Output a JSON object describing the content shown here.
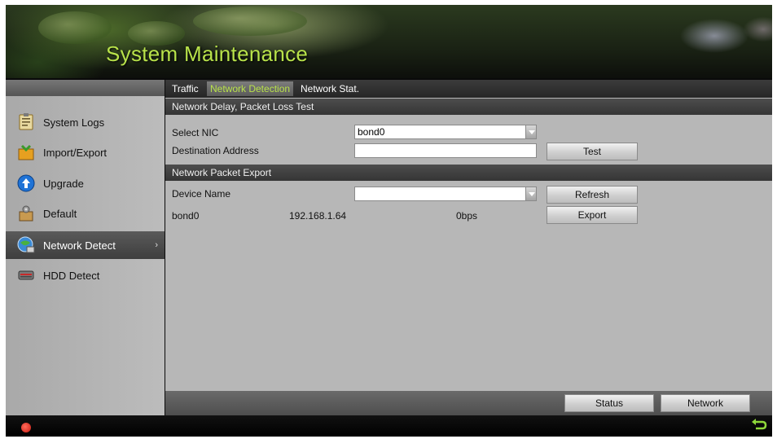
{
  "header": {
    "title": "System Maintenance"
  },
  "sidebar": {
    "items": [
      {
        "label": "System Logs",
        "icon": "system-logs-icon"
      },
      {
        "label": "Import/Export",
        "icon": "import-export-icon"
      },
      {
        "label": "Upgrade",
        "icon": "upgrade-icon"
      },
      {
        "label": "Default",
        "icon": "default-icon"
      },
      {
        "label": "Network Detect",
        "icon": "network-detect-icon",
        "active": true
      },
      {
        "label": "HDD Detect",
        "icon": "hdd-detect-icon"
      }
    ],
    "active_chevron": "›"
  },
  "tabs": [
    {
      "label": "Traffic"
    },
    {
      "label": "Network Detection",
      "active": true
    },
    {
      "label": "Network Stat."
    }
  ],
  "delay_test": {
    "header": "Network Delay, Packet Loss Test",
    "select_nic_label": "Select NIC",
    "select_nic_value": "bond0",
    "destination_label": "Destination Address",
    "destination_value": "",
    "test_button": "Test"
  },
  "packet_export": {
    "header": "Network Packet Export",
    "device_name_label": "Device Name",
    "device_name_value": "",
    "refresh_button": "Refresh",
    "export_button": "Export",
    "row": {
      "interface": "bond0",
      "ip": "192.168.1.64",
      "rate": "0bps"
    }
  },
  "footer": {
    "status_button": "Status",
    "network_button": "Network"
  },
  "colors": {
    "title_accent": "#b8e24a",
    "active_tab_text": "#b8e24a"
  }
}
